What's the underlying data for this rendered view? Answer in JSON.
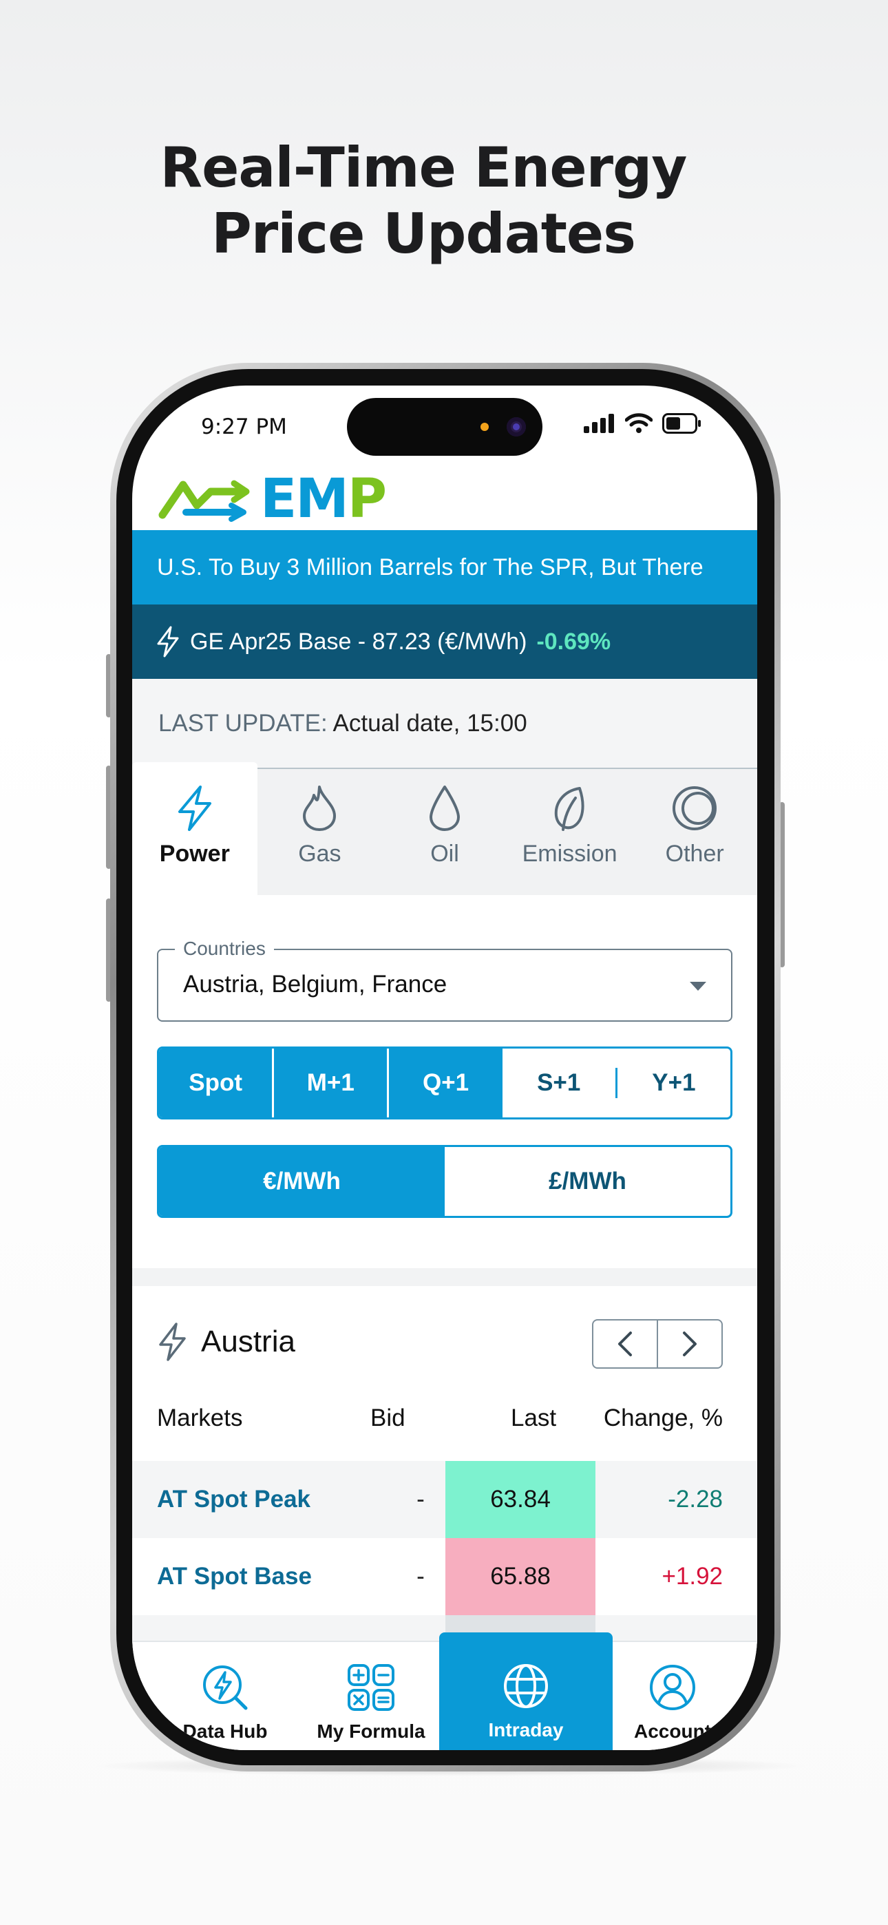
{
  "headline": {
    "line1": "Real-Time Energy",
    "line2": "Price Updates"
  },
  "status_bar": {
    "time": "9:27 PM"
  },
  "logo": {
    "text": "EMP"
  },
  "news_ticker": {
    "text": "U.S. To Buy 3 Million Barrels for The SPR, But There"
  },
  "price_strip": {
    "text": "GE Apr25 Base - 87.23 (€/MWh)",
    "change": "-0.69%"
  },
  "last_update": {
    "label": "LAST UPDATE:",
    "value": "Actual date, 15:00"
  },
  "tabs": [
    {
      "label": "Power",
      "icon": "bolt-icon",
      "active": true
    },
    {
      "label": "Gas",
      "icon": "flame-icon",
      "active": false
    },
    {
      "label": "Oil",
      "icon": "drop-icon",
      "active": false
    },
    {
      "label": "Emission",
      "icon": "leaf-icon",
      "active": false
    },
    {
      "label": "Other",
      "icon": "circles-icon",
      "active": false
    }
  ],
  "countries": {
    "legend": "Countries",
    "value": "Austria, Belgium, France"
  },
  "period_selector": {
    "options": [
      "Spot",
      "M+1",
      "Q+1",
      "S+1",
      "Y+1"
    ],
    "selected": [
      "Spot",
      "M+1",
      "Q+1"
    ]
  },
  "unit_selector": {
    "options": [
      "€/MWh",
      "£/MWh"
    ],
    "selected": "€/MWh"
  },
  "country_card": {
    "title": "Austria",
    "columns": [
      "Markets",
      "Bid",
      "Last",
      "Change, %"
    ],
    "rows": [
      {
        "market": "AT Spot Peak",
        "bid": "-",
        "last": "63.84",
        "change": "-2.28",
        "direction": "down"
      },
      {
        "market": "AT Spot Base",
        "bid": "-",
        "last": "65.88",
        "change": "+1.92",
        "direction": "up"
      }
    ]
  },
  "bottom_nav": [
    {
      "label": "Data Hub",
      "icon": "data-hub-icon",
      "active": false
    },
    {
      "label": "My Formula",
      "icon": "calculator-icon",
      "active": false
    },
    {
      "label": "Intraday",
      "icon": "globe-icon",
      "active": true
    },
    {
      "label": "Account",
      "icon": "user-icon",
      "active": false
    }
  ],
  "colors": {
    "primary": "#0a9ad6",
    "dark_blue": "#0d5575",
    "positive_cell": "#7df2cf",
    "negative_cell": "#f7aebf",
    "change_down": "#0f7d73",
    "change_up": "#d6123a",
    "logo_green": "#7cc21f"
  }
}
